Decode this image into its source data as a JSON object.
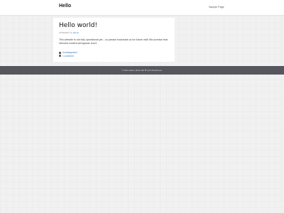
{
  "header": {
    "site_title": "Hello",
    "nav": [
      {
        "label": "Sample Page"
      }
    ]
  },
  "post": {
    "title": "Hello world!",
    "date": "10/06/2021",
    "by": "by",
    "author": "admin",
    "excerpt": "This website is not fully operational yet – so please bookmark us for future visit! We promise that relevant content will appear soon!",
    "category": "Uncategorized",
    "comments": "1 comment"
  },
  "footer": {
    "text": "© 2021 Hello | Built with ❤ and WordPress."
  }
}
